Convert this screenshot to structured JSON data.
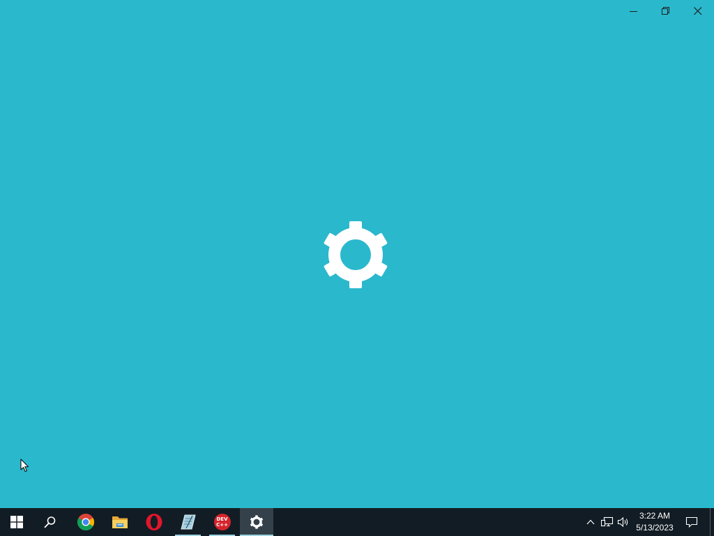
{
  "colors": {
    "splash_background": "#2ab8cc",
    "foreground": "#ffffff",
    "taskbar_background": "#121c24",
    "taskbar_active": "#35414a",
    "taskbar_running_indicator": "#9fd3e0"
  },
  "window": {
    "controls": [
      {
        "icon": "minimize-icon"
      },
      {
        "icon": "restore-icon"
      },
      {
        "icon": "close-icon"
      }
    ],
    "splash_icon": "gear-icon"
  },
  "taskbar": {
    "items": [
      {
        "icon": "windows-logo-icon",
        "running": false,
        "active": false
      },
      {
        "icon": "search-icon",
        "running": false,
        "active": false
      },
      {
        "icon": "chrome-icon",
        "running": false,
        "active": false
      },
      {
        "icon": "folder-icon",
        "running": false,
        "active": false
      },
      {
        "icon": "opera-icon",
        "running": false,
        "active": false
      },
      {
        "icon": "notepad-icon",
        "running": true,
        "active": false
      },
      {
        "icon": "devcpp-icon",
        "label": "DEV\nC++",
        "running": true,
        "active": false
      },
      {
        "icon": "settings-gear-icon",
        "running": true,
        "active": true
      }
    ],
    "tray": {
      "icons": [
        "chevron-up-icon",
        "network-icon",
        "volume-icon"
      ],
      "time": "3:22 AM",
      "date": "5/13/2023",
      "notification_icon": "notification-icon"
    }
  }
}
